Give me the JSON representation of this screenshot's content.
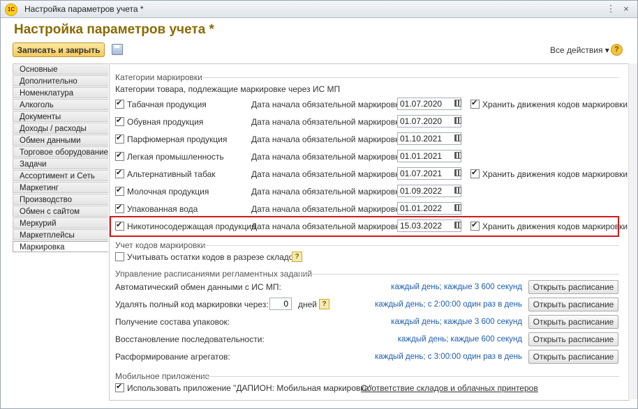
{
  "window": {
    "logo": "1С",
    "title": "Настройка параметров учета *",
    "more_icon": "⋮",
    "close_icon": "×"
  },
  "page_title": "Настройка параметров учета *",
  "toolbar": {
    "save_close_label": "Записать и закрыть",
    "all_actions_label": "Все действия ▾",
    "help_label": "?"
  },
  "sidebar": {
    "items": [
      {
        "label": "Основные"
      },
      {
        "label": "Дополнительно"
      },
      {
        "label": "Номенклатура"
      },
      {
        "label": "Алкоголь"
      },
      {
        "label": "Документы"
      },
      {
        "label": "Доходы / расходы"
      },
      {
        "label": "Обмен данными"
      },
      {
        "label": "Торговое оборудование"
      },
      {
        "label": "Задачи"
      },
      {
        "label": "Ассортимент и Сеть"
      },
      {
        "label": "Маркетинг"
      },
      {
        "label": "Производство"
      },
      {
        "label": "Обмен с сайтом"
      },
      {
        "label": "Меркурий"
      },
      {
        "label": "Маркетплейсы"
      },
      {
        "label": "Маркировка",
        "active": true
      }
    ]
  },
  "marking": {
    "section_title": "Категории маркировки",
    "subtitle_link": "Категории товара, подлежащие маркировке через ИС МП",
    "date_label": "Дата начала обязательной маркировки:",
    "store_label": "Хранить движения кодов маркировки",
    "rows": [
      {
        "name": "Табачная продукция",
        "checked": true,
        "date": "01.07.2020",
        "store": true
      },
      {
        "name": "Обувная продукция",
        "checked": true,
        "date": "01.07.2020",
        "store": false
      },
      {
        "name": "Парфюмерная продукция",
        "checked": true,
        "date": "01.10.2021",
        "store": false
      },
      {
        "name": "Легкая промышленность",
        "checked": true,
        "date": "01.01.2021",
        "store": false
      },
      {
        "name": "Альтернативный табак",
        "checked": true,
        "date": "01.07.2021",
        "store": true
      },
      {
        "name": "Молочная продукция",
        "checked": true,
        "date": "01.09.2022",
        "store": false
      },
      {
        "name": "Упакованная вода",
        "checked": true,
        "date": "01.01.2022",
        "store": false
      },
      {
        "name": "Никотиносодержащая продукция",
        "checked": true,
        "date": "15.03.2022",
        "store": true
      }
    ]
  },
  "codes_accounting": {
    "section_title": "Учет кодов маркировки",
    "checkbox_label": "Учитывать остатки кодов в разрезе складов",
    "checked": false,
    "help": "?"
  },
  "schedules": {
    "section_title": "Управление расписаниями регламентных заданий",
    "button_label": "Открыть расписание",
    "days_label": "дней",
    "days_value": "0",
    "help": "?",
    "rows": [
      {
        "label": "Автоматический обмен данными с ИС МП:",
        "schedule": "каждый день; каждые 3 600 секунд"
      },
      {
        "label": "Удалять полный код маркировки через:",
        "schedule": "каждый день; с 2:00:00 один раз в день"
      },
      {
        "label": "Получение состава упаковок:",
        "schedule": "каждый день; каждые 3 600 секунд"
      },
      {
        "label": "Восстановление последовательности:",
        "schedule": "каждый день; каждые 600 секунд"
      },
      {
        "label": "Расформирование агрегатов:",
        "schedule": "каждый день; с 3:00:00 один раз в день"
      }
    ]
  },
  "mobile": {
    "section_title": "Мобильное приложение",
    "checkbox_label": "Использовать приложение \"ДАПИОН: Мобильная маркировка\"",
    "checked": true,
    "link": "Соответствие складов и облачных принтеров"
  }
}
